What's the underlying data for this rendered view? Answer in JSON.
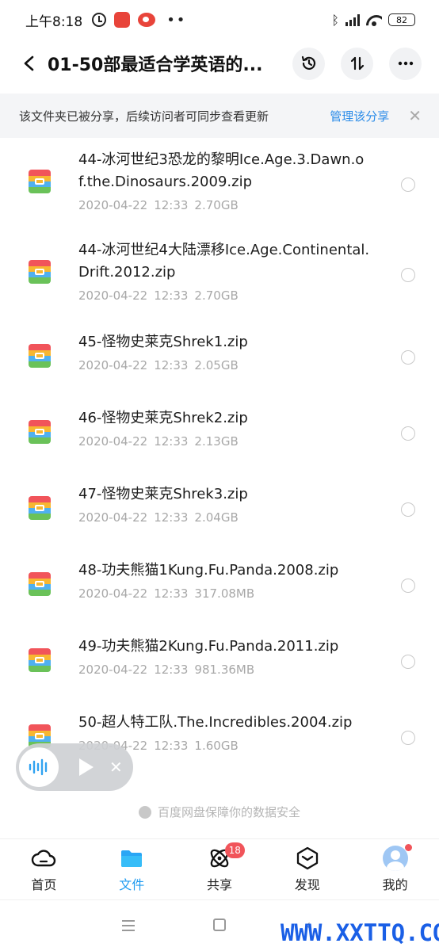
{
  "status_bar": {
    "time": "上午8:18",
    "battery": "82"
  },
  "header": {
    "title": "01-50部最适合学英语的..."
  },
  "share_banner": {
    "text": "该文件夹已被分享，后续访问者可同步查看更新",
    "manage_label": "管理该分享",
    "close_glyph": "✕"
  },
  "files": [
    {
      "name": "44-冰河世纪3恐龙的黎明Ice.Age.3.Dawn.of.the.Dinosaurs.2009.zip",
      "date": "2020-04-22",
      "time": "12:33",
      "size": "2.70GB"
    },
    {
      "name": "44-冰河世纪4大陆漂移Ice.Age.Continental.Drift.2012.zip",
      "date": "2020-04-22",
      "time": "12:33",
      "size": "2.70GB"
    },
    {
      "name": "45-怪物史莱克Shrek1.zip",
      "date": "2020-04-22",
      "time": "12:33",
      "size": "2.05GB"
    },
    {
      "name": "46-怪物史莱克Shrek2.zip",
      "date": "2020-04-22",
      "time": "12:33",
      "size": "2.13GB"
    },
    {
      "name": "47-怪物史莱克Shrek3.zip",
      "date": "2020-04-22",
      "time": "12:33",
      "size": "2.04GB"
    },
    {
      "name": "48-功夫熊猫1Kung.Fu.Panda.2008.zip",
      "date": "2020-04-22",
      "time": "12:33",
      "size": "317.08MB"
    },
    {
      "name": "49-功夫熊猫2Kung.Fu.Panda.2011.zip",
      "date": "2020-04-22",
      "time": "12:33",
      "size": "981.36MB"
    },
    {
      "name": "50-超人特工队.The.Incredibles.2004.zip",
      "date": "2020-04-22",
      "time": "12:33",
      "size": "1.60GB"
    }
  ],
  "safe_note": "百度网盘保障你的数据安全",
  "tabs": [
    {
      "label": "首页",
      "icon": "cloud-icon"
    },
    {
      "label": "文件",
      "icon": "folder-icon",
      "active": true
    },
    {
      "label": "共享",
      "icon": "atom-icon",
      "badge": "18"
    },
    {
      "label": "发现",
      "icon": "discover-icon"
    },
    {
      "label": "我的",
      "icon": "avatar-icon",
      "dot": true
    }
  ],
  "watermark": "WWW.XXTTQ.COM",
  "colors": {
    "accent": "#1f9bf0",
    "link": "#2b8ce8",
    "badge": "#f1545a",
    "watermark": "#1a5fe6"
  }
}
